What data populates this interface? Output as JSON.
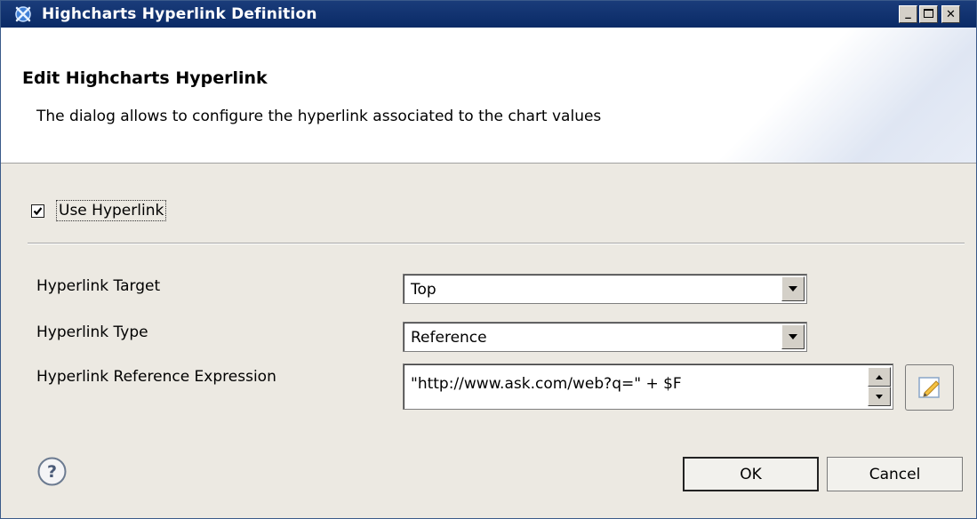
{
  "window": {
    "title": "Highcharts Hyperlink Definition",
    "controls": {
      "minimize": "_",
      "maximize": "□",
      "close": "✕"
    }
  },
  "header": {
    "title": "Edit Highcharts Hyperlink",
    "description": "The dialog allows to configure the hyperlink associated to the chart values"
  },
  "use_hyperlink": {
    "label": "Use Hyperlink",
    "checked": true
  },
  "fields": {
    "target": {
      "label": "Hyperlink Target",
      "value": "Top"
    },
    "type": {
      "label": "Hyperlink Type",
      "value": "Reference"
    },
    "reference_expression": {
      "label": "Hyperlink Reference Expression",
      "value": "\"http://www.ask.com/web?q=\" + $F"
    }
  },
  "buttons": {
    "ok": "OK",
    "cancel": "Cancel"
  },
  "icons": {
    "app": "app-icon",
    "edit_expression": "pencil-icon",
    "help": "help-icon",
    "dropdown": "chevron-down-icon"
  },
  "colors": {
    "titlebar": "#0a2a66",
    "banner_accent": "#dfe6f3"
  }
}
